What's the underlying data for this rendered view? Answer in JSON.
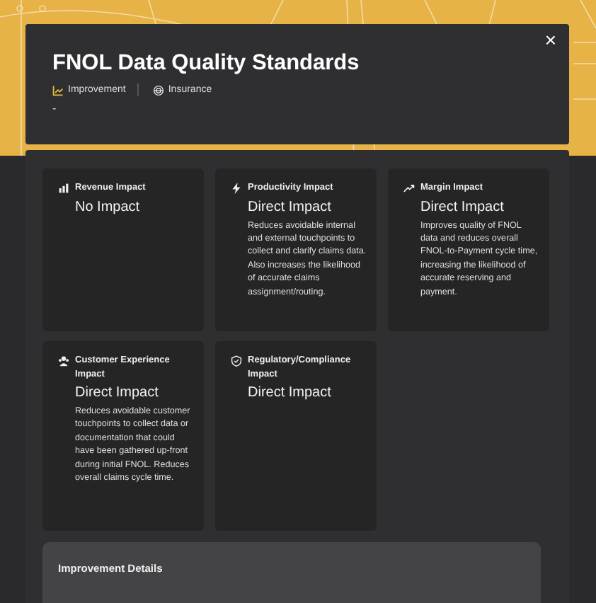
{
  "modal": {
    "title": "FNOL Data Quality Standards",
    "close_icon": "×",
    "tags": [
      {
        "kind": "improvement",
        "label": "Improvement"
      },
      {
        "kind": "industry",
        "label": "Insurance"
      }
    ],
    "subtitle": "-"
  },
  "impacts": [
    {
      "kind": "revenue",
      "title": "Revenue Impact",
      "value": "No Impact"
    },
    {
      "kind": "productivity",
      "title": "Productivity Impact",
      "value": "Direct Impact",
      "description": "Reduces avoidable internal and external touchpoints to collect and clarify claims data. Also increases the likelihood of accurate claims assignment/routing."
    },
    {
      "kind": "margin",
      "title": "Margin Impact",
      "value": "Direct Impact",
      "description": "Improves quality of FNOL data and reduces overall FNOL-to-Payment cycle time, increasing the likelihood of accurate reserving and payment."
    },
    {
      "kind": "customer",
      "title": "Customer Experience Impact",
      "value": "Direct Impact",
      "description": "Reduces avoidable customer touchpoints to collect data or documentation that could have been gathered up-front during initial FNOL. Reduces overall claims cycle time."
    },
    {
      "kind": "regulatory",
      "title": "Regulatory/Compliance Impact",
      "value": "Direct Impact"
    }
  ],
  "details": {
    "title": "Improvement Details"
  }
}
